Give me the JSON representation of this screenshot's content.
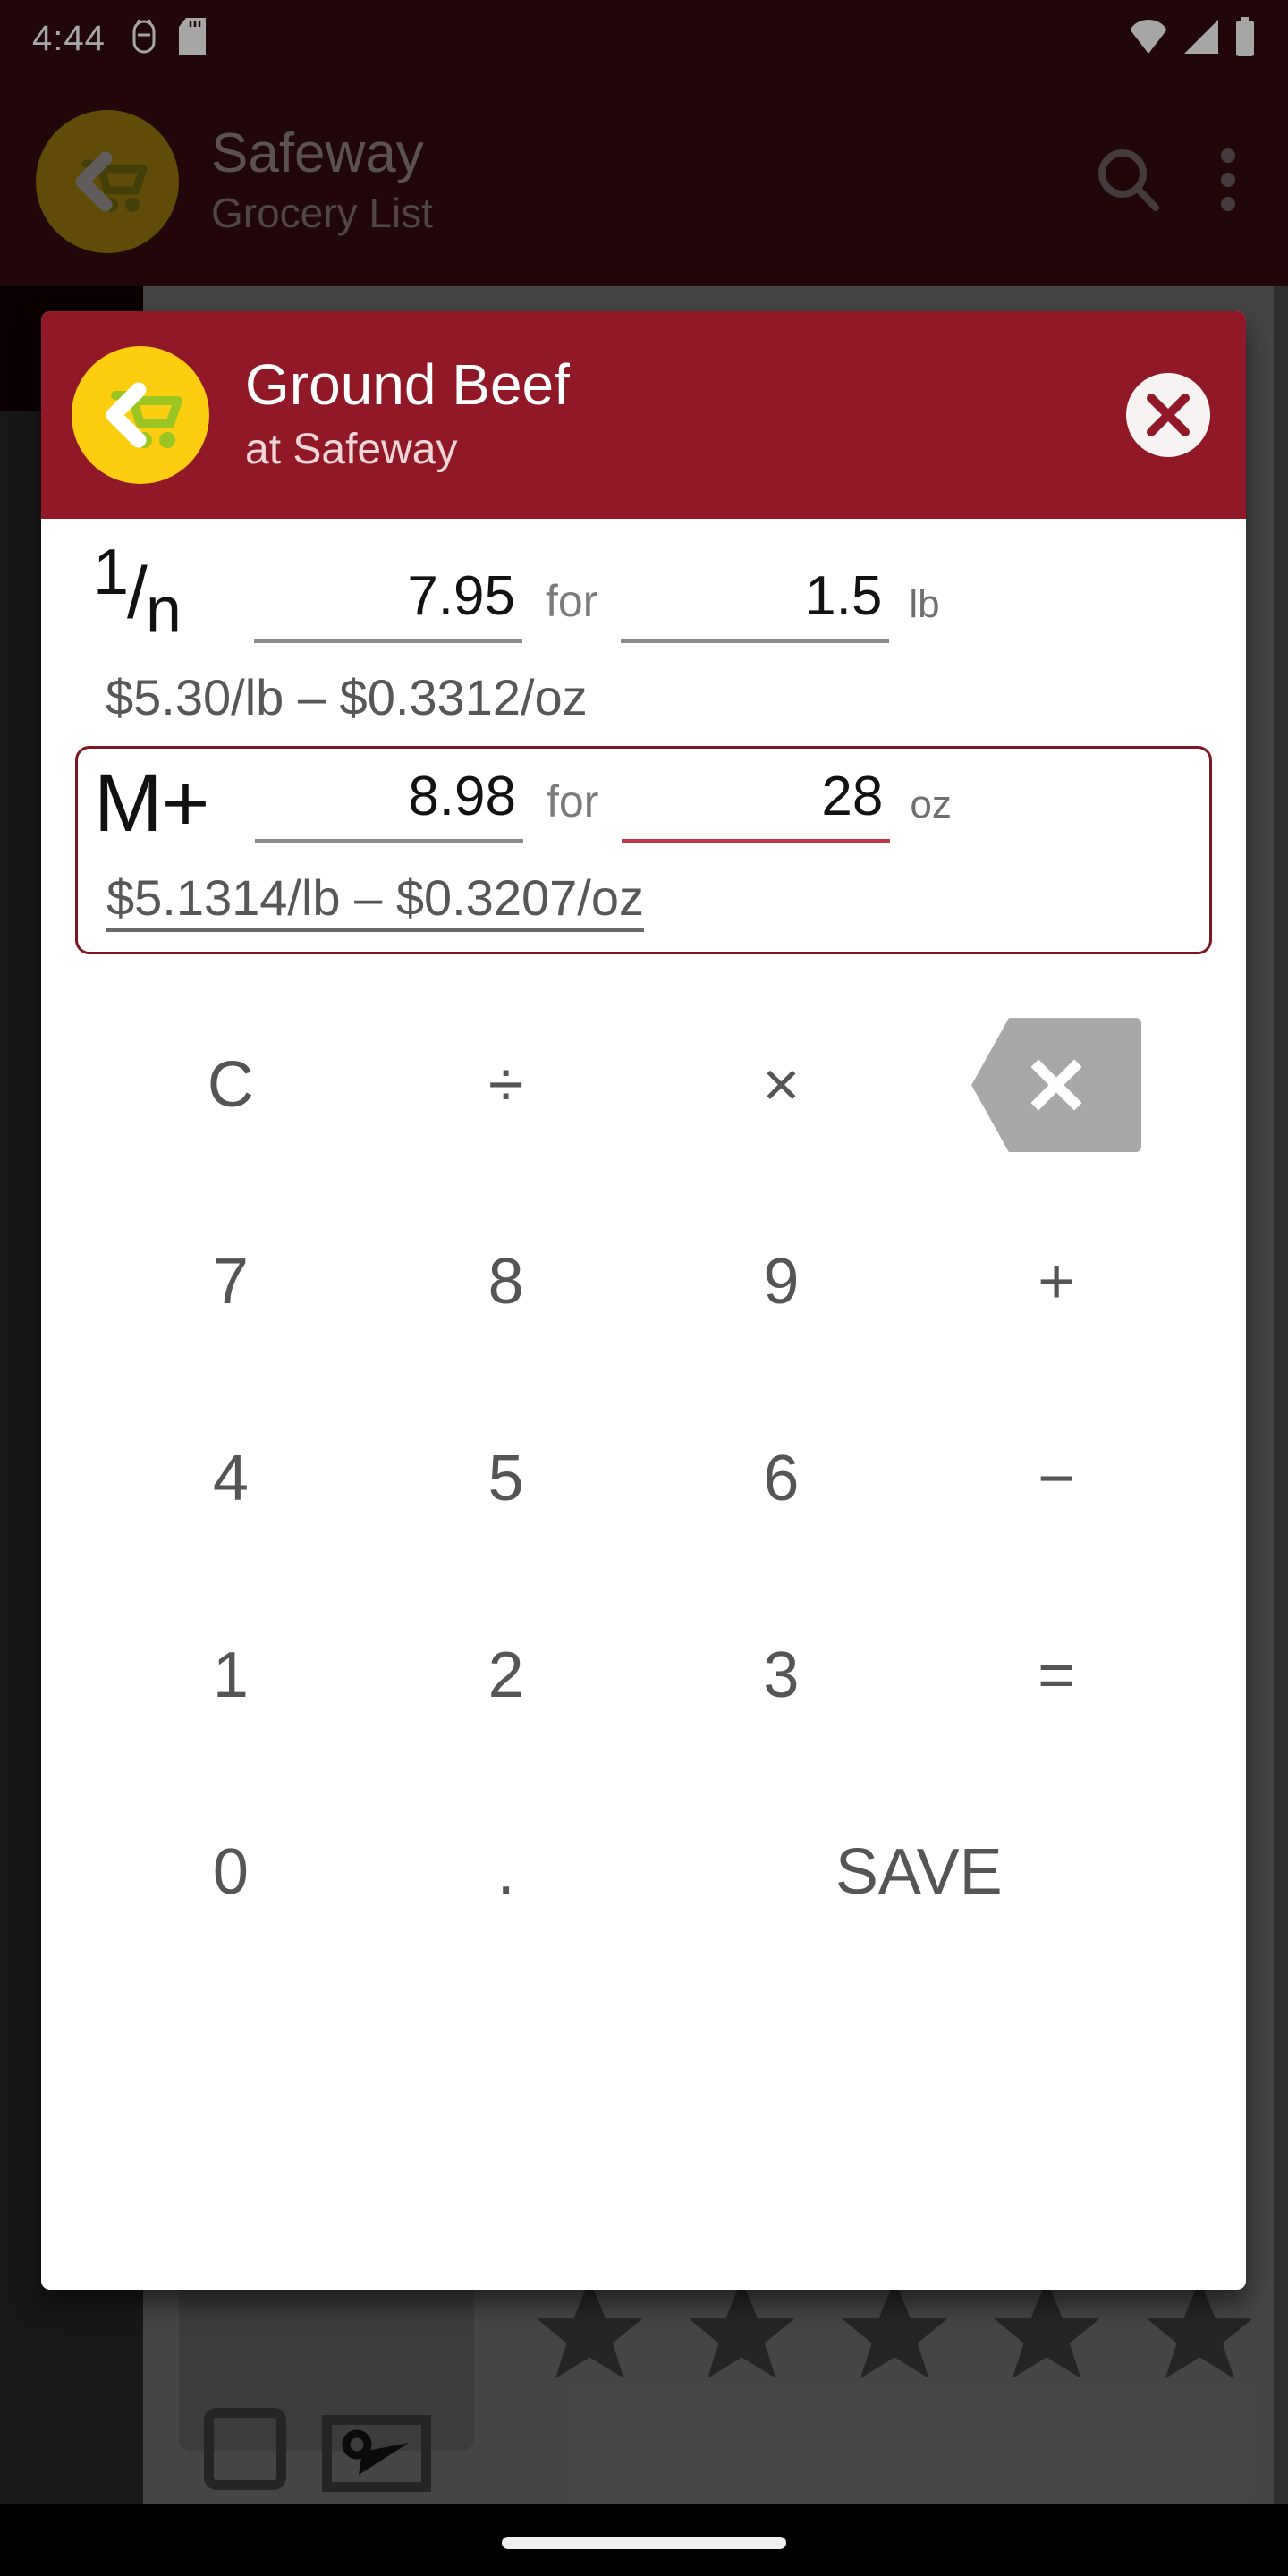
{
  "status_bar": {
    "time": "4:44",
    "left_icons": [
      "clock-icon",
      "sd-card-icon"
    ],
    "right_icons": [
      "wifi-icon",
      "cell-signal-icon",
      "battery-icon"
    ]
  },
  "background_app": {
    "back_button_icon": "back-cart-icon",
    "title": "Safeway",
    "subtitle": "Grocery List",
    "search_icon": "search-icon",
    "overflow_icon": "more-vert-icon",
    "stars_count": 5,
    "checkbox_icon": "checkbox-icon",
    "scribble_icon": "note-icon"
  },
  "dialog": {
    "back_button_icon": "back-cart-icon",
    "title": "Ground Beef",
    "subtitle": "at Safeway",
    "close_icon": "close-circle-icon",
    "rows": [
      {
        "label_type": "fraction",
        "label_num": "1",
        "label_slash": "/",
        "label_den": "n",
        "price": "7.95",
        "for_word": "for",
        "quantity": "1.5",
        "unit": "lb",
        "result": "$5.30/lb – $0.3312/oz",
        "active": false,
        "focused_field": "none"
      },
      {
        "label_type": "text",
        "label_text": "M+",
        "price": "8.98",
        "for_word": "for",
        "quantity": "28",
        "unit": "oz",
        "result": "$5.1314/lb – $0.3207/oz",
        "active": true,
        "focused_field": "quantity"
      }
    ],
    "keypad": {
      "row1": [
        "C",
        "÷",
        "×",
        "backspace-icon"
      ],
      "row2": [
        "7",
        "8",
        "9",
        "+"
      ],
      "row3": [
        "4",
        "5",
        "6",
        "−"
      ],
      "row4": [
        "1",
        "2",
        "3",
        "="
      ],
      "row5": [
        "0",
        ".",
        "SAVE"
      ]
    }
  },
  "colors": {
    "dialog_header": "#911927",
    "accent_yellow": "#FCCE0F",
    "cart_green": "#9BC520",
    "active_border": "#7E1622",
    "focused_underline": "#C03A4B",
    "key_text": "#555555",
    "backspace_key": "#A8A8A8"
  },
  "nav_bar": {
    "handle": "home-handle"
  }
}
